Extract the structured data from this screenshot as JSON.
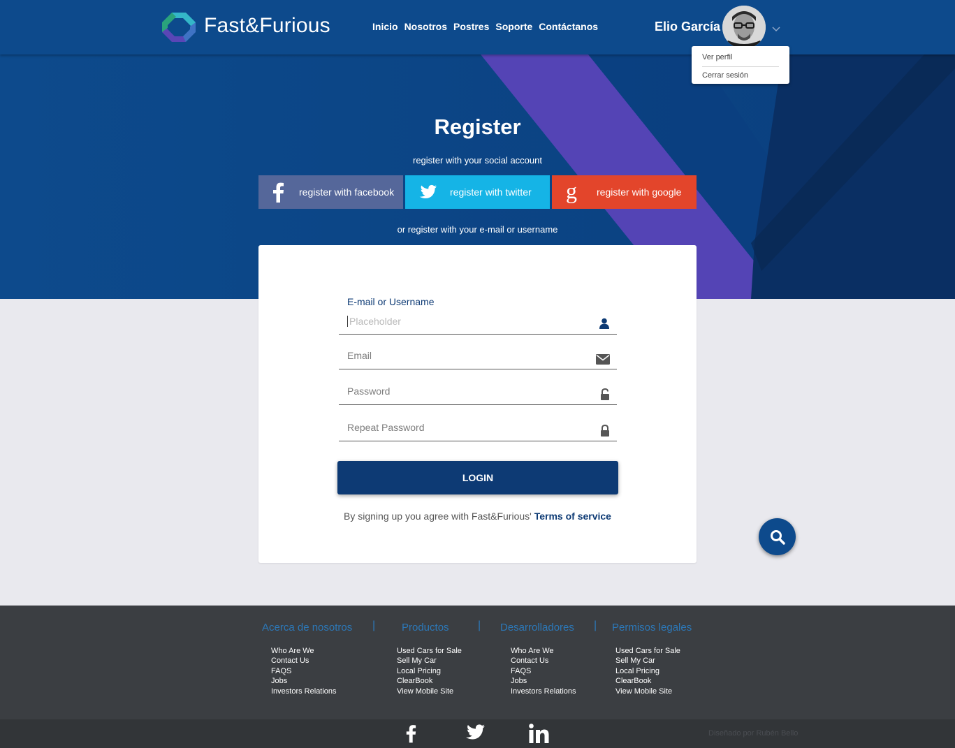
{
  "header": {
    "brand": "Fast&Furious",
    "nav": [
      "Inicio",
      "Nosotros",
      "Postres",
      "Soporte",
      "Contáctanos"
    ],
    "user_name": "Elio García",
    "dropdown": [
      "Ver perfil",
      "Cerrar sesión"
    ]
  },
  "hero": {
    "title": "Register",
    "social_subtitle": "register with your social account",
    "social_buttons": [
      {
        "label": "register with facebook",
        "icon": "facebook-icon",
        "color": "#55679a"
      },
      {
        "label": "register with twitter",
        "icon": "twitter-icon",
        "color": "#15b4e6"
      },
      {
        "label": "register with google",
        "icon": "google-icon",
        "color": "#e3452b"
      }
    ],
    "or_text": "or register with your e-mail or username"
  },
  "form": {
    "username_label": "E-mail or Username",
    "username_placeholder": "Placeholder",
    "email_placeholder": "Email",
    "password_placeholder": "Password",
    "repeat_password_placeholder": "Repeat Password",
    "login_label": "LOGIN",
    "terms_prefix": "By signing up you agree with Fast&Furious' ",
    "terms_link": "Terms of service"
  },
  "footer": {
    "columns": [
      {
        "heading": "Acerca de nosotros",
        "links": [
          "Who Are We",
          "Contact Us",
          "FAQS",
          "Jobs",
          "Investors Relations"
        ]
      },
      {
        "heading": "Productos",
        "links": [
          "Used Cars for Sale",
          "Sell My Car",
          "Local Pricing",
          "ClearBook",
          "View Mobile Site"
        ]
      },
      {
        "heading": "Desarrolladores",
        "links": [
          "Who Are We",
          "Contact Us",
          "FAQS",
          "Jobs",
          "Investors Relations"
        ]
      },
      {
        "heading": "Permisos legales",
        "links": [
          "Used Cars for Sale",
          "Sell My Car",
          "Local Pricing",
          "ClearBook",
          "View Mobile Site"
        ]
      }
    ],
    "social_icons": [
      "facebook-icon",
      "twitter-icon",
      "linkedin-icon"
    ],
    "credit": "Diseñado por Rubén Bello"
  },
  "colors": {
    "primary": "#0d4a8c",
    "dark_primary": "#0d3a74",
    "purple_stripe": "#5444b5",
    "footer_bg": "#3b3e42",
    "footer_heading": "#2c78b8"
  }
}
